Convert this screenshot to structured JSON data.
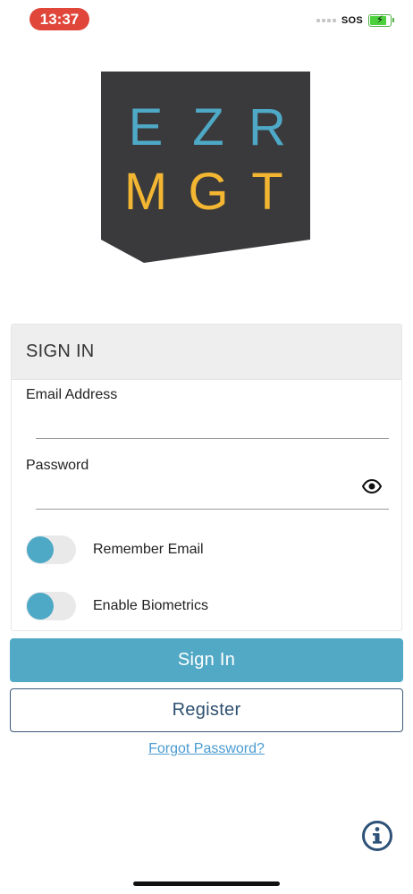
{
  "status_bar": {
    "time": "13:37",
    "carrier": "SOS",
    "icons": [
      "signal-icon",
      "battery-charging-icon"
    ],
    "battery_color": "#4cd13d",
    "battery_level": 0.75
  },
  "logo": {
    "row1": [
      "E",
      "Z",
      "R"
    ],
    "row2": [
      "M",
      "G",
      "T"
    ],
    "background_color": "#3a3a3c",
    "row1_color": "#4ea9c6",
    "row2_color": "#f2b632"
  },
  "signin_card": {
    "header": "SIGN IN",
    "email": {
      "label": "Email Address",
      "value": "",
      "placeholder": ""
    },
    "password": {
      "label": "Password",
      "value": "",
      "placeholder": "",
      "icon": "eye-icon"
    },
    "remember_email": {
      "label": "Remember Email",
      "state": "off"
    },
    "enable_biometrics": {
      "label": "Enable Biometrics",
      "state": "off"
    }
  },
  "buttons": {
    "sign_in": "Sign In",
    "register": "Register"
  },
  "links": {
    "forgot_password": "Forgot Password?"
  },
  "footer": {
    "icon": "info-icon"
  },
  "colors": {
    "accent": "#52a9c5",
    "register_border": "#3c5a7a",
    "link": "#4a9bd1",
    "time_pill": "#e0463a"
  }
}
